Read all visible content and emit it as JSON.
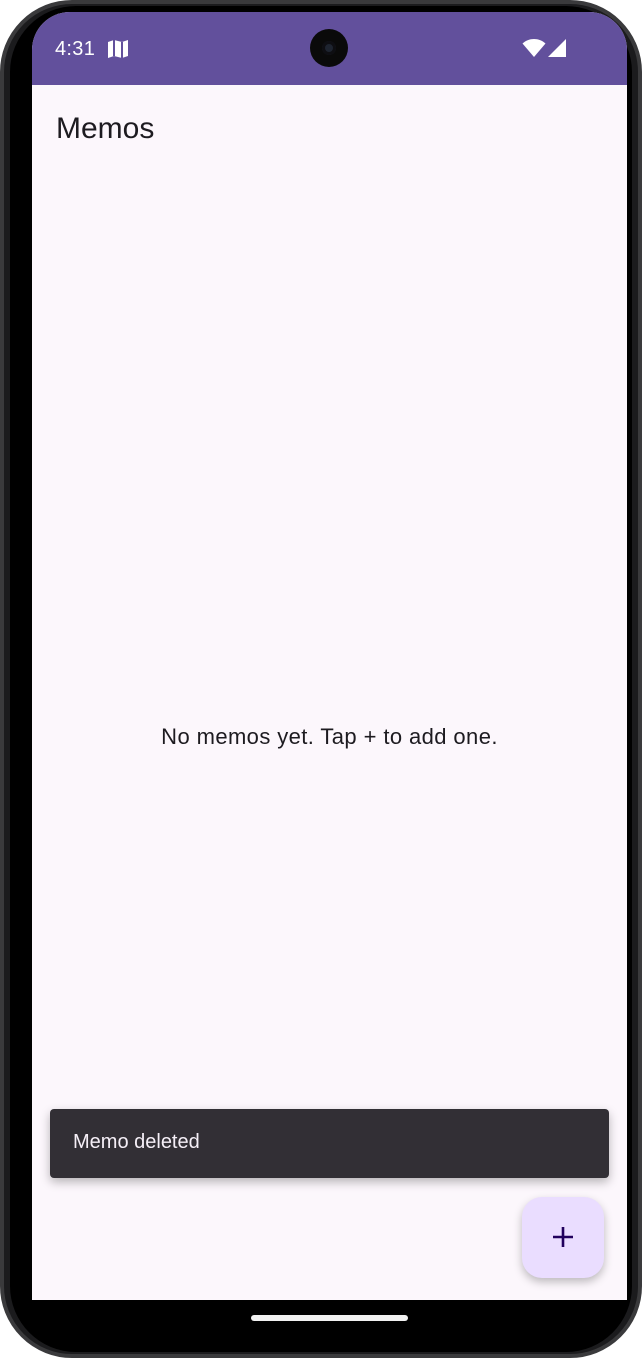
{
  "status_bar": {
    "time": "4:31",
    "icons": [
      "map-icon",
      "wifi-icon",
      "signal-icon"
    ],
    "background_color": "#62509c"
  },
  "app": {
    "title": "Memos",
    "empty_message": "No memos yet. Tap + to add one."
  },
  "snackbar": {
    "message": "Memo deleted"
  },
  "fab": {
    "icon": "plus-icon",
    "label": "+"
  },
  "colors": {
    "screen_background": "#fcf7fc",
    "snackbar_background": "#322f35",
    "fab_background": "#eaddff",
    "fab_icon": "#21005d"
  }
}
